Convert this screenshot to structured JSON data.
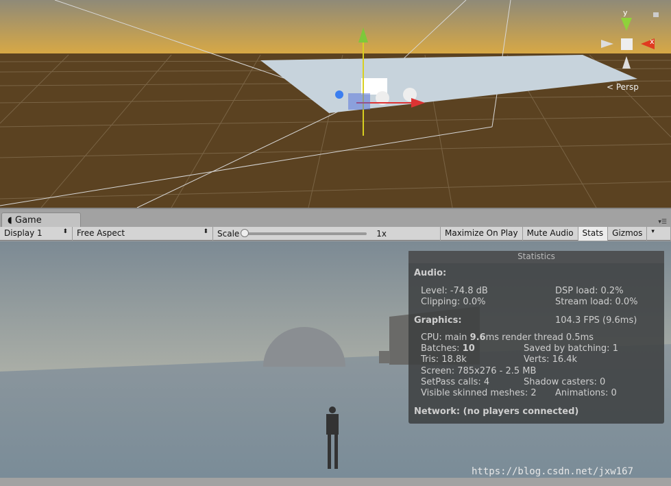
{
  "scene_view": {
    "projection_label": "< Persp",
    "gizmo_axes": {
      "y": "y",
      "x": "x"
    }
  },
  "game_tab": {
    "label": "Game",
    "icon": "pacman-icon"
  },
  "toolbar": {
    "display": "Display 1",
    "aspect": "Free Aspect",
    "scale_label": "Scale",
    "scale_value": "1x",
    "scale_slider_fraction": 0,
    "maximize_on_play": "Maximize On Play",
    "mute_audio": "Mute Audio",
    "stats": "Stats",
    "gizmos": "Gizmos"
  },
  "statistics": {
    "title": "Statistics",
    "audio_header": "Audio:",
    "level": "Level: -74.8 dB",
    "dsp_load": "DSP load: 0.2%",
    "clipping": "Clipping: 0.0%",
    "stream_load": "Stream load: 0.0%",
    "graphics_header": "Graphics:",
    "fps": "104.3 FPS (9.6ms)",
    "cpu_prefix": "CPU: main ",
    "cpu_main": "9.6",
    "cpu_suffix": "ms  render thread 0.5ms",
    "batches_prefix": "Batches: ",
    "batches": "10",
    "saved_by_batching": "Saved by batching: 1",
    "tris": "Tris: 18.8k",
    "verts": "Verts: 16.4k",
    "screen": "Screen: 785x276 - 2.5 MB",
    "setpass": "SetPass calls: 4",
    "shadow_casters": "Shadow casters: 0",
    "skinned_meshes": "Visible skinned meshes: 2",
    "animations": "Animations: 0",
    "network": "Network: (no players connected)"
  },
  "watermark": "https://blog.csdn.net/jxw167"
}
